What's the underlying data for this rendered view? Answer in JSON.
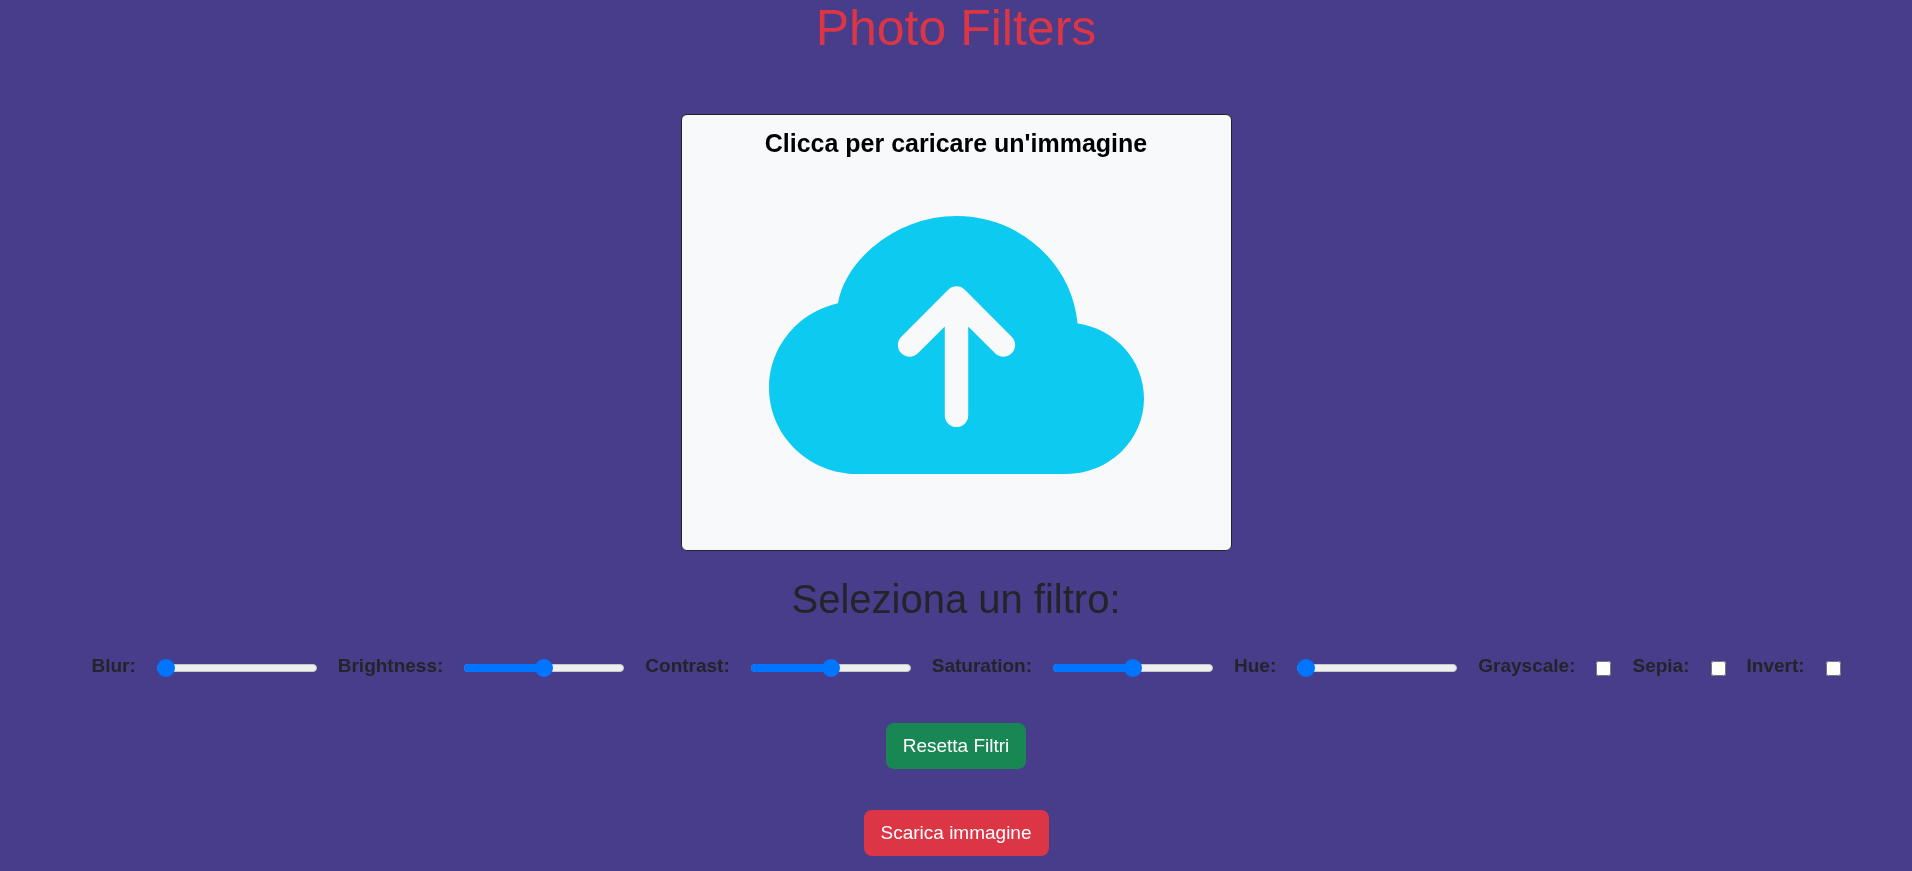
{
  "title": "Photo Filters",
  "upload": {
    "prompt": "Clicca per caricare un'immagine"
  },
  "filters_heading": "Seleziona un filtro:",
  "filters": [
    {
      "kind": "slider",
      "label": "Blur:",
      "level": 0
    },
    {
      "kind": "slider",
      "label": "Brightness:",
      "level": 0.5
    },
    {
      "kind": "slider",
      "label": "Contrast:",
      "level": 0.5
    },
    {
      "kind": "slider",
      "label": "Saturation:",
      "level": 0.5
    },
    {
      "kind": "slider",
      "label": "Hue:",
      "level": 0
    },
    {
      "kind": "checkbox",
      "label": "Grayscale:",
      "checked": false
    },
    {
      "kind": "checkbox",
      "label": "Sepia:",
      "checked": false
    },
    {
      "kind": "checkbox",
      "label": "Invert:",
      "checked": false
    }
  ],
  "buttons": [
    {
      "kind": "reset",
      "label": "Resetta Filtri"
    },
    {
      "kind": "download",
      "label": "Scarica immagine"
    }
  ]
}
